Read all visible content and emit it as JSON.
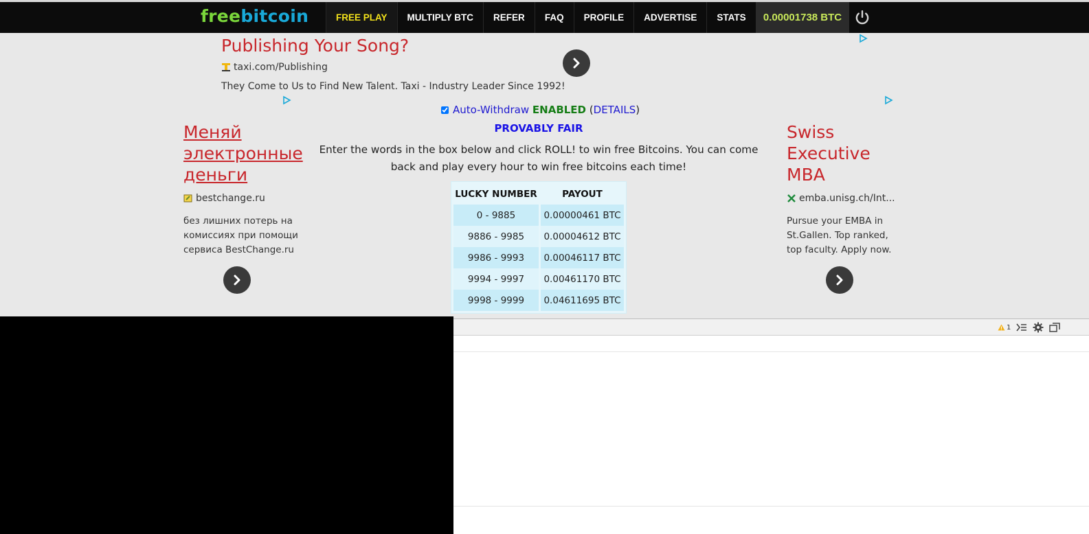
{
  "logo": {
    "part1": "free",
    "part2": "bitcoin"
  },
  "nav": {
    "items": [
      {
        "label": "FREE PLAY",
        "active": true
      },
      {
        "label": "MULTIPLY BTC",
        "active": false
      },
      {
        "label": "REFER",
        "active": false
      },
      {
        "label": "FAQ",
        "active": false
      },
      {
        "label": "PROFILE",
        "active": false
      },
      {
        "label": "ADVERTISE",
        "active": false
      },
      {
        "label": "STATS",
        "active": false
      }
    ],
    "balance": "0.00001738 BTC",
    "power_icon": "power-icon"
  },
  "ads": {
    "top": {
      "title": "Publishing Your Song?",
      "url": "taxi.com/Publishing",
      "desc": "They Come to Us to Find New Talent. Taxi - Industry Leader Since 1992!"
    },
    "left": {
      "title_lines": [
        "Меняй",
        "электронные",
        "деньги"
      ],
      "url": "bestchange.ru",
      "desc_lines": [
        "без лишних потерь на",
        "комиссиях при помощи",
        "сервиса BestChange.ru"
      ]
    },
    "right": {
      "title_lines": [
        "Swiss",
        "Executive",
        "MBA"
      ],
      "url": "emba.unisg.ch/Int...",
      "desc_lines": [
        "Pursue your EMBA in",
        "St.Gallen. Top ranked,",
        "top faculty. Apply now."
      ]
    }
  },
  "auto_withdraw": {
    "label": "Auto-Withdraw",
    "status": "ENABLED",
    "open_paren": "(",
    "details": "DETAILS",
    "close_paren": ")"
  },
  "provably_fair": "PROVABLY FAIR",
  "instructions": "Enter the words in the box below and click ROLL! to win free Bitcoins. You can come back and play every hour to win free bitcoins each time!",
  "payout_table": {
    "headers": [
      "LUCKY NUMBER",
      "PAYOUT"
    ],
    "rows": [
      [
        "0 - 9885",
        "0.00000461 BTC"
      ],
      [
        "9886 - 9985",
        "0.00004612 BTC"
      ],
      [
        "9986 - 9993",
        "0.00046117 BTC"
      ],
      [
        "9994 - 9997",
        "0.00461170 BTC"
      ],
      [
        "9998 - 9999",
        "0.04611695 BTC"
      ]
    ]
  },
  "devtools": {
    "warning_count": "1"
  },
  "colors": {
    "navbar": "#0c0c0c",
    "active_nav": "#f3e21b",
    "balance": "#c8e85a",
    "ad_title": "#c8262b",
    "link_blue": "#1a13e6",
    "enabled_green": "#157d15"
  }
}
